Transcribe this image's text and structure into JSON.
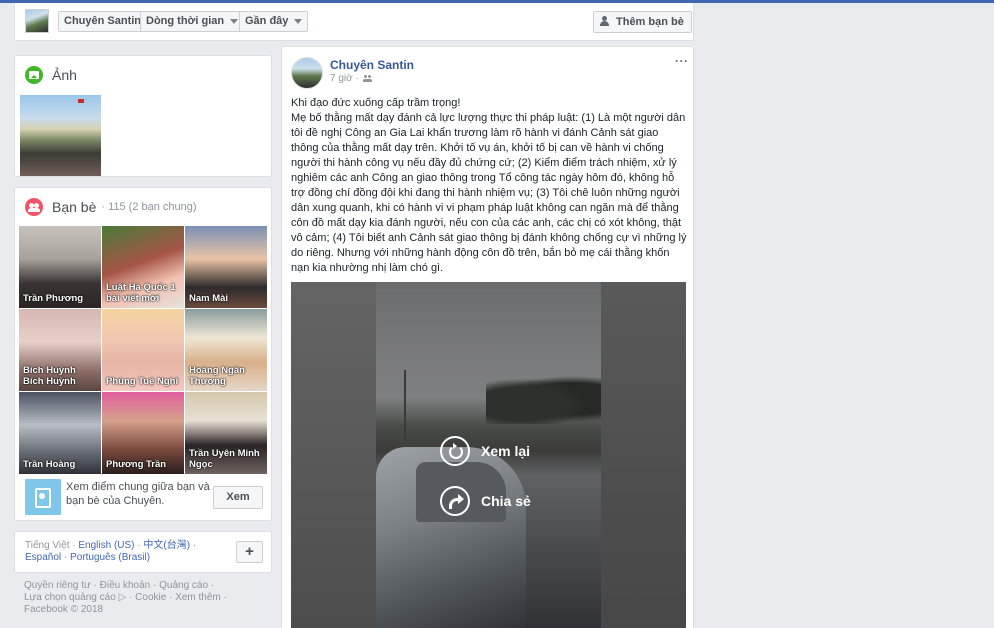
{
  "nav": {
    "profile_name": "Chuyên Santin",
    "timeline_label": "Dòng thời gian",
    "recent_label": "Gần đây",
    "add_friend_label": "Thêm bạn bè"
  },
  "photos": {
    "title": "Ảnh"
  },
  "friends": {
    "title": "Bạn bè",
    "count": "· 115 (2 bạn chung)",
    "items": [
      {
        "name": "Trần Phương"
      },
      {
        "name": "Luật Hà Quốc 1 bài viết mới"
      },
      {
        "name": "Nam Mài"
      },
      {
        "name": "Bích Huỳnh Bích Huỳnh"
      },
      {
        "name": "Phùng Tuệ Nghi"
      },
      {
        "name": "Hoàng Ngân Thương"
      },
      {
        "name": "Trần Hoàng"
      },
      {
        "name": "Phương Trần"
      },
      {
        "name": "Trần Uyên Minh Ngọc"
      }
    ],
    "suggest_text": "Xem điểm chung giữa bạn và bạn bè của Chuyên.",
    "suggest_button": "Xem"
  },
  "languages": {
    "items": [
      "Tiếng Việt",
      "English (US)",
      "中文(台灣)",
      "Español",
      "Português (Brasil)"
    ],
    "add_label": "+"
  },
  "footer": {
    "privacy": "Quyền riêng tư",
    "terms": "Điều khoản",
    "ads": "Quảng cáo",
    "ad_choices": "Lựa chọn quảng cáo",
    "ad_choices_icon": "▷",
    "cookies": "Cookie",
    "more": "Xem thêm",
    "copyright": "Facebook © 2018"
  },
  "post": {
    "author": "Chuyên Santin",
    "time": "7 giờ ·",
    "more_label": "···",
    "text_line1": "Khi đạo đức xuống cấp trầm trọng!",
    "text_body": "Mẹ bố thằng mất dạy đánh cả lực lượng thực thi pháp luật: (1) Là một người dân tôi đề nghị Công an Gia Lai khẩn trương làm rõ hành vi đánh Cảnh sát giao thông của thằng mất dạy trên. Khởi tố vụ án, khởi tố bị can về hành vi chống người thi hành công vụ nếu đầy đủ chứng cứ; (2) Kiểm điểm trách nhiệm, xử lý nghiêm các anh Công an giao thông trong Tổ công tác ngày hôm đó, không hỗ trợ đồng chí đồng đội khi đang thi hành nhiệm vụ; (3) Tôi chê luôn những người dân xung quanh, khi có hành vi vi phạm pháp luật không can ngăn mà để thằng côn đồ mất dạy kia đánh người, nếu con của các anh, các chị có xót không, thật vô cảm; (4) Tôi biết anh Cảnh sát giao thông bị đánh không chống cự vì những lý do riêng. Nhưng với những hành động côn đồ trên, bắn bỏ mẹ cái thằng khốn nạn kia nhường nhị làm chó gì.",
    "video": {
      "replay_label": "Xem lại",
      "share_label": "Chia sẻ"
    }
  }
}
